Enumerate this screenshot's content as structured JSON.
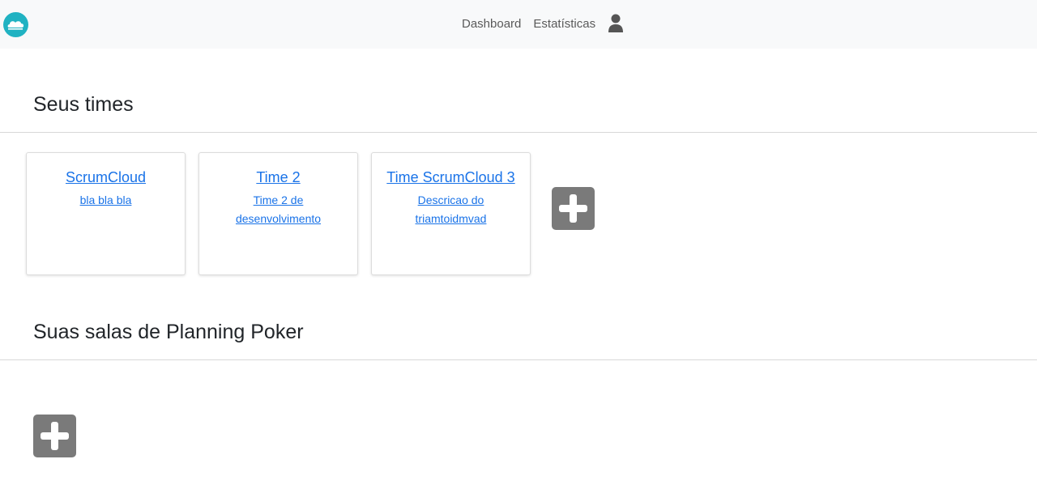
{
  "navbar": {
    "logo_icon": "cloud-icon",
    "links": [
      "Dashboard",
      "Estatísticas"
    ],
    "user_icon": "user-icon"
  },
  "teams_section": {
    "title": "Seus times",
    "cards": [
      {
        "title": "ScrumCloud",
        "description": "bla bla bla"
      },
      {
        "title": "Time 2",
        "description": "Time 2 de desenvolvimento"
      },
      {
        "title": "Time ScrumCloud 3",
        "description": "Descricao do triamtoidmvad"
      }
    ],
    "add_icon": "plus-icon"
  },
  "poker_section": {
    "title": "Suas salas de Planning Poker",
    "add_icon": "plus-icon"
  },
  "colors": {
    "navbar_bg": "#f8f9fa",
    "link": "#1a73e8",
    "logo": "#20b2c2",
    "add_button": "#7a7a7a"
  }
}
